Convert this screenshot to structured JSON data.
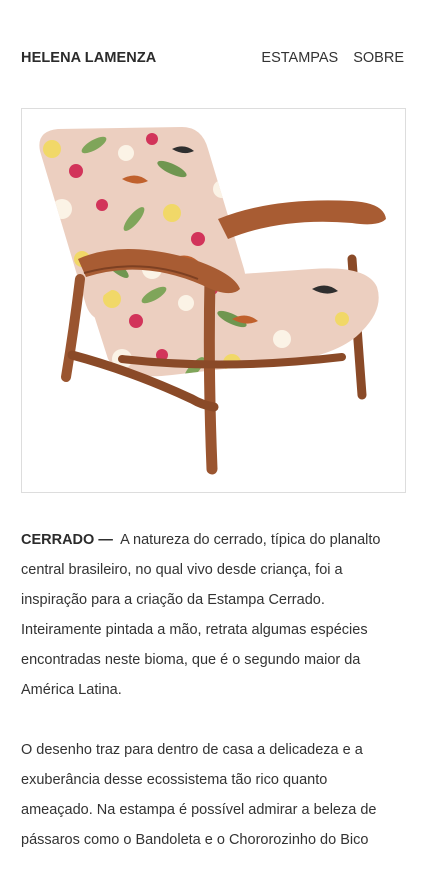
{
  "header": {
    "brand": "HELENA LAMENZA",
    "nav": [
      {
        "label": "ESTAMPAS"
      },
      {
        "label": "SOBRE"
      }
    ]
  },
  "article": {
    "lead_title": "CERRADO —",
    "paragraph_1": "A natureza do cerrado, típica do planalto central brasileiro, no qual vivo desde criança, foi a inspiração para a criação da Estampa Cerrado. Inteiramente pintada a mão, retrata algumas espécies encontradas neste bioma, que é o segundo maior da América Latina.",
    "paragraph_2": "O desenho traz para dentro de casa a delicadeza e a exuberância desse ecossistema tão rico quanto ameaçado. Na estampa é possível admirar a beleza de pássaros como o Bandoleta e o Chororozinho do Bico"
  },
  "colors": {
    "wood": "#9a5530",
    "fabric": "#eccfc0",
    "accent_pink": "#d2345a",
    "leaf": "#7fa55a",
    "flower_yellow": "#f1d868"
  }
}
